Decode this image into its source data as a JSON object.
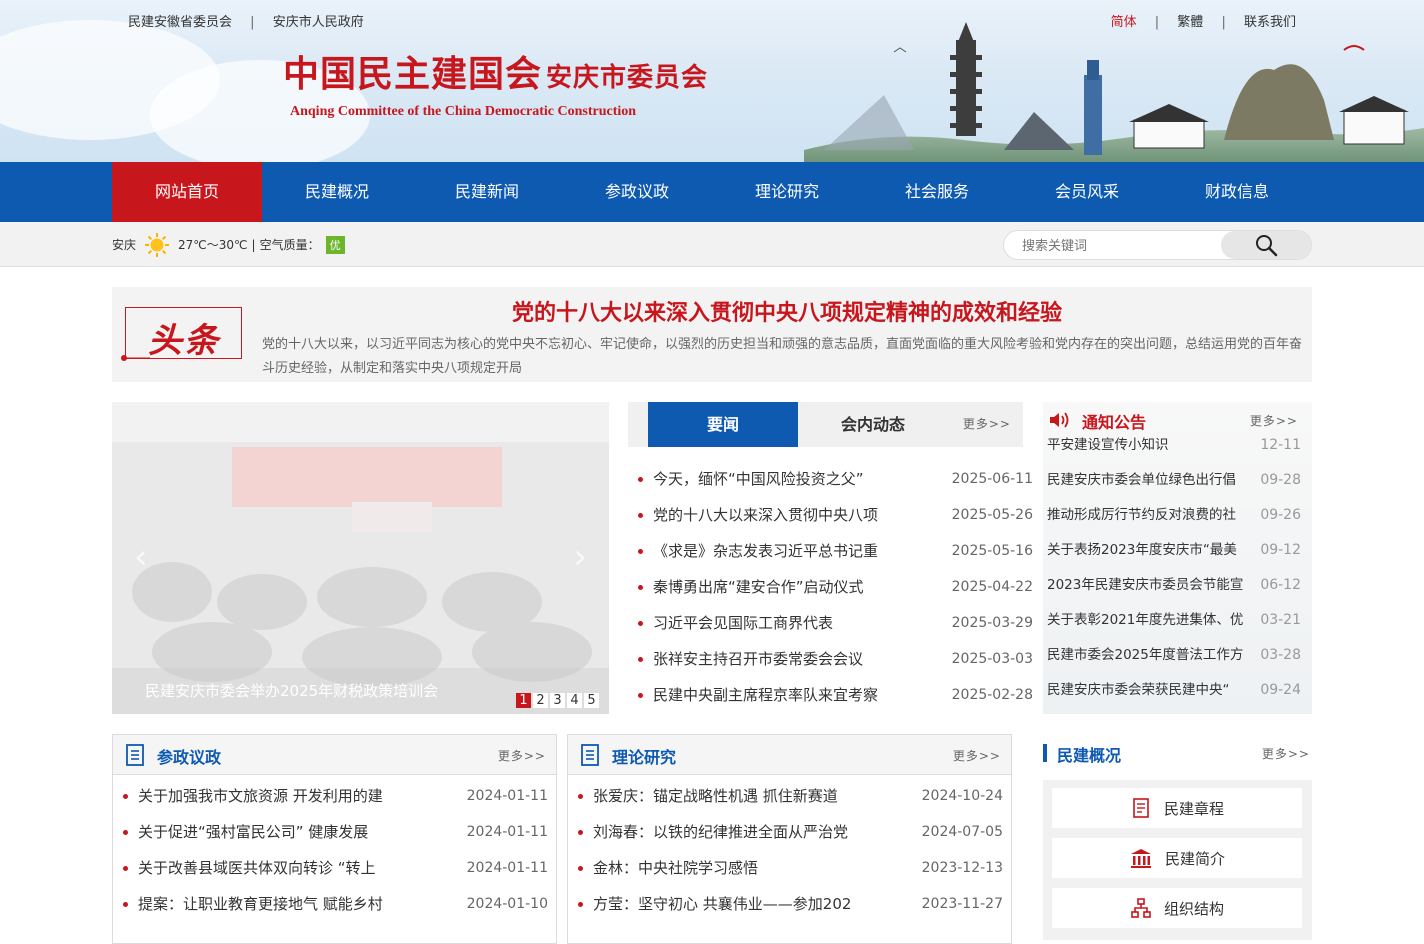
{
  "header": {
    "top_links": [
      "民建安徽省委员会",
      "安庆市人民政府"
    ],
    "lang_links": [
      "简体",
      "繁體",
      "联系我们"
    ],
    "logo_title": "中国民主建国会",
    "logo_suffix": "安庆市委员会",
    "logo_english": "Anqing Committee of the China Democratic Construction"
  },
  "nav": {
    "items": [
      "网站首页",
      "民建概况",
      "民建新闻",
      "参政议政",
      "理论研究",
      "社会服务",
      "会员风采",
      "财政信息"
    ],
    "active_index": 0
  },
  "weather": {
    "city": "安庆",
    "icon": "sun-icon",
    "temperature": "27℃～30℃",
    "air_label": "空气质量：",
    "air_value": "优"
  },
  "search": {
    "placeholder": "搜索关键词",
    "icon": "magnifier-icon"
  },
  "headline": {
    "badge": "头条",
    "title": "党的十八大以来深入贯彻中央八项规定精神的成效和经验",
    "summary": "党的十八大以来，以习近平同志为核心的党中央不忘初心、牢记使命，以强烈的历史担当和顽强的意志品质，直面党面临的重大风险考验和党内存在的突出问题，总结运用党的百年奋斗历史经验，从制定和落实中央八项规定开局"
  },
  "slider": {
    "caption": "民建安庆市委会举办2025年财税政策培训会",
    "pages": [
      "1",
      "2",
      "3",
      "4",
      "5"
    ],
    "active_page": 0
  },
  "news": {
    "tabs": [
      "要闻",
      "会内动态"
    ],
    "more": "更多>>",
    "items": [
      {
        "title": "今天，缅怀“中国风险投资之父”",
        "date": "2025-06-11"
      },
      {
        "title": "党的十八大以来深入贯彻中央八项",
        "date": "2025-05-26"
      },
      {
        "title": "《求是》杂志发表习近平总书记重",
        "date": "2025-05-16"
      },
      {
        "title": "秦博勇出席“建安合作”启动仪式",
        "date": "2025-04-22"
      },
      {
        "title": "习近平会见国际工商界代表",
        "date": "2025-03-29"
      },
      {
        "title": "张祥安主持召开市委常委会会议",
        "date": "2025-03-03"
      },
      {
        "title": "民建中央副主席程京率队来宜考察",
        "date": "2025-02-28"
      }
    ]
  },
  "notice": {
    "title": "通知公告",
    "more": "更多>>",
    "items": [
      {
        "title": "平安建设宣传小知识",
        "date": "12-11"
      },
      {
        "title": "民建安庆市委会单位绿色出行倡",
        "date": "09-28"
      },
      {
        "title": "推动形成厉行节约反对浪费的社",
        "date": "09-26"
      },
      {
        "title": "关于表扬2023年度安庆市“最美",
        "date": "09-12"
      },
      {
        "title": "2023年民建安庆市委员会节能宣",
        "date": "06-12"
      },
      {
        "title": "关于表彰2021年度先进集体、优",
        "date": "03-21"
      },
      {
        "title": "民建市委会2025年度普法工作方",
        "date": "03-28"
      },
      {
        "title": "民建安庆市委会荣获民建中央“",
        "date": "09-24"
      }
    ]
  },
  "panel_canzheng": {
    "title": "参政议政",
    "more": "更多>>",
    "items": [
      {
        "title": "关于加强我市文旅资源 开发利用的建",
        "date": "2024-01-11"
      },
      {
        "title": "关于促进“强村富民公司” 健康发展",
        "date": "2024-01-11"
      },
      {
        "title": "关于改善县域医共体双向转诊 “转上",
        "date": "2024-01-11"
      },
      {
        "title": "提案：让职业教育更接地气 赋能乡村",
        "date": "2024-01-10"
      }
    ]
  },
  "panel_lilun": {
    "title": "理论研究",
    "more": "更多>>",
    "items": [
      {
        "title": "张爱庆：锚定战略性机遇 抓住新赛道",
        "date": "2024-10-24"
      },
      {
        "title": "刘海春：以铁的纪律推进全面从严治党",
        "date": "2024-07-05"
      },
      {
        "title": "金林：中央社院学习感悟",
        "date": "2023-12-13"
      },
      {
        "title": "方莹：坚守初心 共襄伟业——参加202",
        "date": "2023-11-27"
      }
    ]
  },
  "overview": {
    "title": "民建概况",
    "more": "更多>>",
    "buttons": [
      "民建章程",
      "民建简介",
      "组织结构"
    ]
  },
  "colors": {
    "brand_red": "#c8161d",
    "brand_blue": "#0e5ab1"
  }
}
